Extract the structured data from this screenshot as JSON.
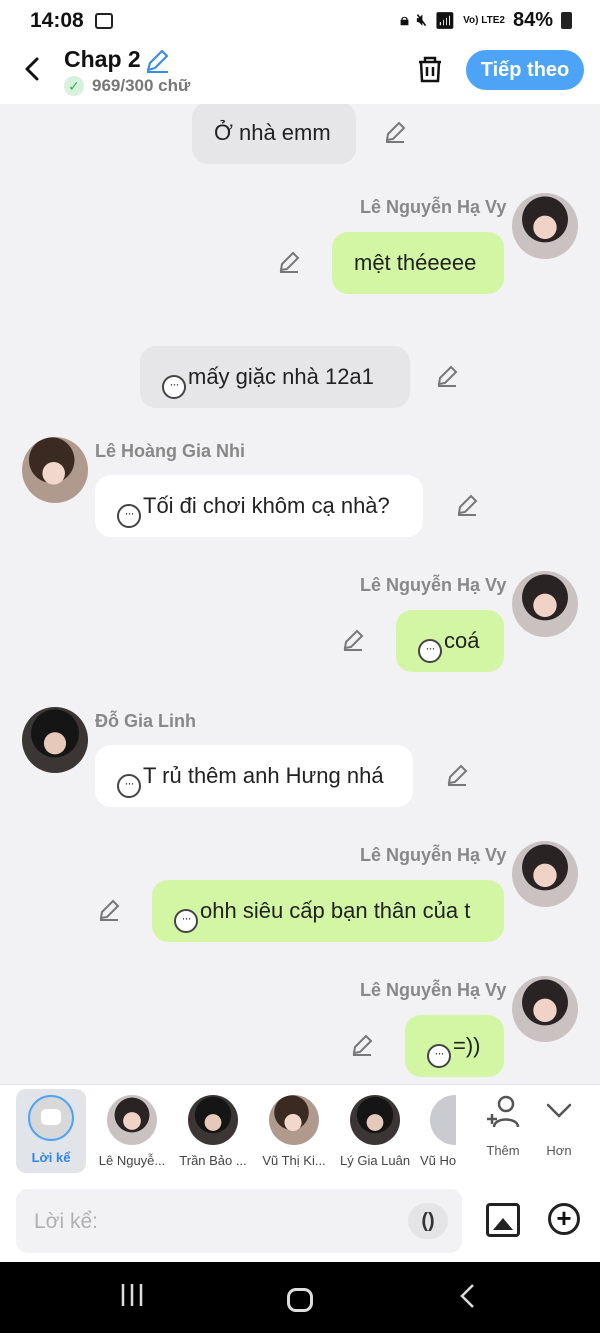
{
  "status": {
    "time": "14:08",
    "network": "Vo) LTE2",
    "battery": "84%"
  },
  "header": {
    "title": "Chap 2",
    "word_count": "969/300 chữ",
    "next_label": "Tiếp theo"
  },
  "messages": [
    {
      "type": "narration",
      "text": "Ở nhà emm"
    },
    {
      "type": "right",
      "sender": "Lê Nguyễn Hạ Vy",
      "text": "mệt théeeee"
    },
    {
      "type": "narration",
      "text": "mấy giặc nhà 12a1",
      "thought": true
    },
    {
      "type": "left",
      "sender": "Lê Hoàng Gia Nhi",
      "text": "Tối đi chơi khôm cạ nhà?",
      "thought": true
    },
    {
      "type": "right",
      "sender": "Lê Nguyễn Hạ Vy",
      "text": "coá",
      "thought": true
    },
    {
      "type": "left",
      "sender": "Đỗ Gia Linh",
      "text": "T rủ thêm anh Hưng nhá",
      "thought": true
    },
    {
      "type": "right",
      "sender": "Lê Nguyễn Hạ Vy",
      "text": "ohh siêu cấp bạn thân của t",
      "thought": true
    },
    {
      "type": "right",
      "sender": "Lê Nguyễn Hạ Vy",
      "text": "=))",
      "thought": true
    }
  ],
  "characters": {
    "narrator": "Lời kể",
    "items": [
      "Lê Nguyễ...",
      "Trần Bảo ...",
      "Vũ Thị Ki...",
      "Lý Gia Luân",
      "Vũ Ho"
    ],
    "add_label": "Thêm",
    "more_label": "Hơn"
  },
  "composer": {
    "placeholder": "Lời kể:",
    "paren_label": "()"
  },
  "icons": {
    "back": "chevron-left-icon",
    "edit": "pencil-icon",
    "check": "check-icon",
    "trash": "trash-icon",
    "thought": "speech-dots-icon",
    "add_person": "add-person-icon",
    "more": "chevron-down-icon",
    "image": "image-icon",
    "plus": "plus-circle-icon"
  },
  "colors": {
    "accent": "#4da3f5",
    "bubble_green": "#d3f6a5",
    "bubble_white": "#ffffff",
    "bubble_gray": "#e6e6e8"
  }
}
